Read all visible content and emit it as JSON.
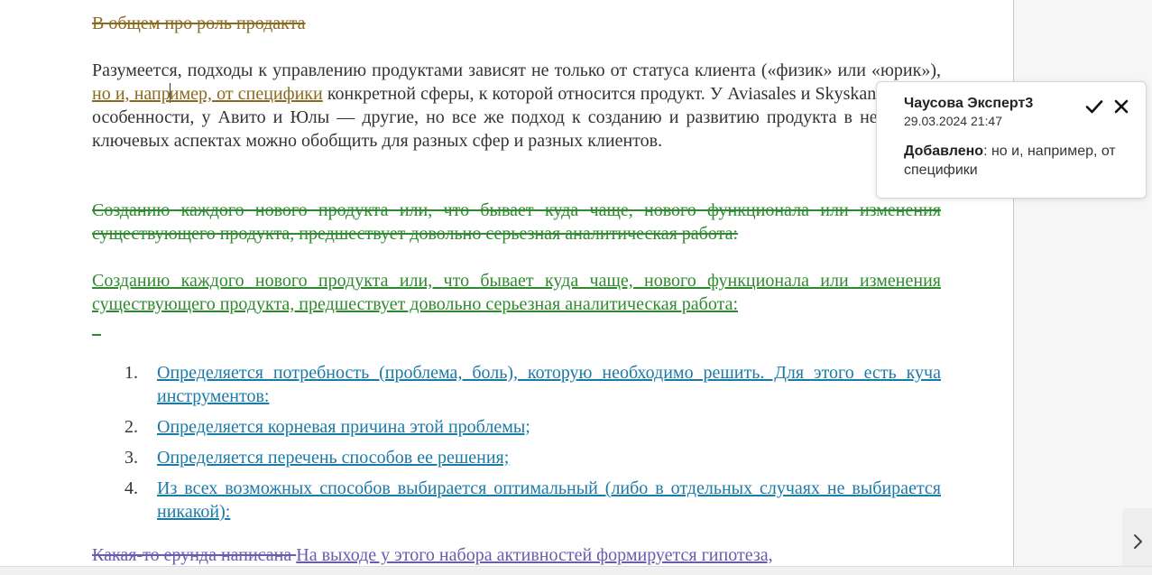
{
  "document": {
    "heading_deleted": "В общем про роль продакта ",
    "p1": {
      "part1": "Разумеется, подходы к управлению продуктами зависят не только от статуса клиента («физик» или «юрик»), ",
      "inserted_a": "но и, напр",
      "inserted_b": "имер, от специфики",
      "part2": " конкретной сферы, к которой относится продукт. У Aviasales и Skyskanner одни особенности, у Авито и Юлы — другие, но все же подход к созданию и развитию продукта в некоторых ключевых аспектах можно обобщить для разных сфер и разных клиентов."
    },
    "p2_deleted": "Созданию каждого нового продукта или, что бывает куда чаще, нового функционала или изменения существующего продукта, предшествует довольно серьезная аналитическая работа: ",
    "p2_inserted": "Созданию каждого нового продукта или, что бывает куда чаще, нового функционала или изменения существующего продукта, предшествует довольно серьезная аналитическая работа: ",
    "list": [
      {
        "num": "1.",
        "text": "Определяется потребность (проблема, боль), которую необходимо решить. Для этого есть куча инструментов: "
      },
      {
        "num": "2.",
        "text": "Определяется корневая причина этой проблемы; "
      },
      {
        "num": "3.",
        "text": "Определяется перечень способов ее решения; "
      },
      {
        "num": "4.",
        "text": "Из всех возможных способов выбирается оптимальный (либо в отдельных случаях не выбирается никакой): "
      }
    ],
    "p3_deleted": "Какая-то ерунда написана ",
    "p3_inserted": "На выходе у этого набора активностей формируется гипотеза,"
  },
  "comment": {
    "author": "Чаусова Эксперт3",
    "date": "29.03.2024 21:47",
    "label": "Добавлено",
    "text": ": но и, например, от специфики",
    "accept_icon": "checkmark-icon",
    "reject_icon": "close-icon"
  },
  "colors": {
    "brown": "#8a6a1f",
    "green": "#2f8a2f",
    "blue": "#1a7aa8",
    "purple": "#6a5ab0"
  }
}
